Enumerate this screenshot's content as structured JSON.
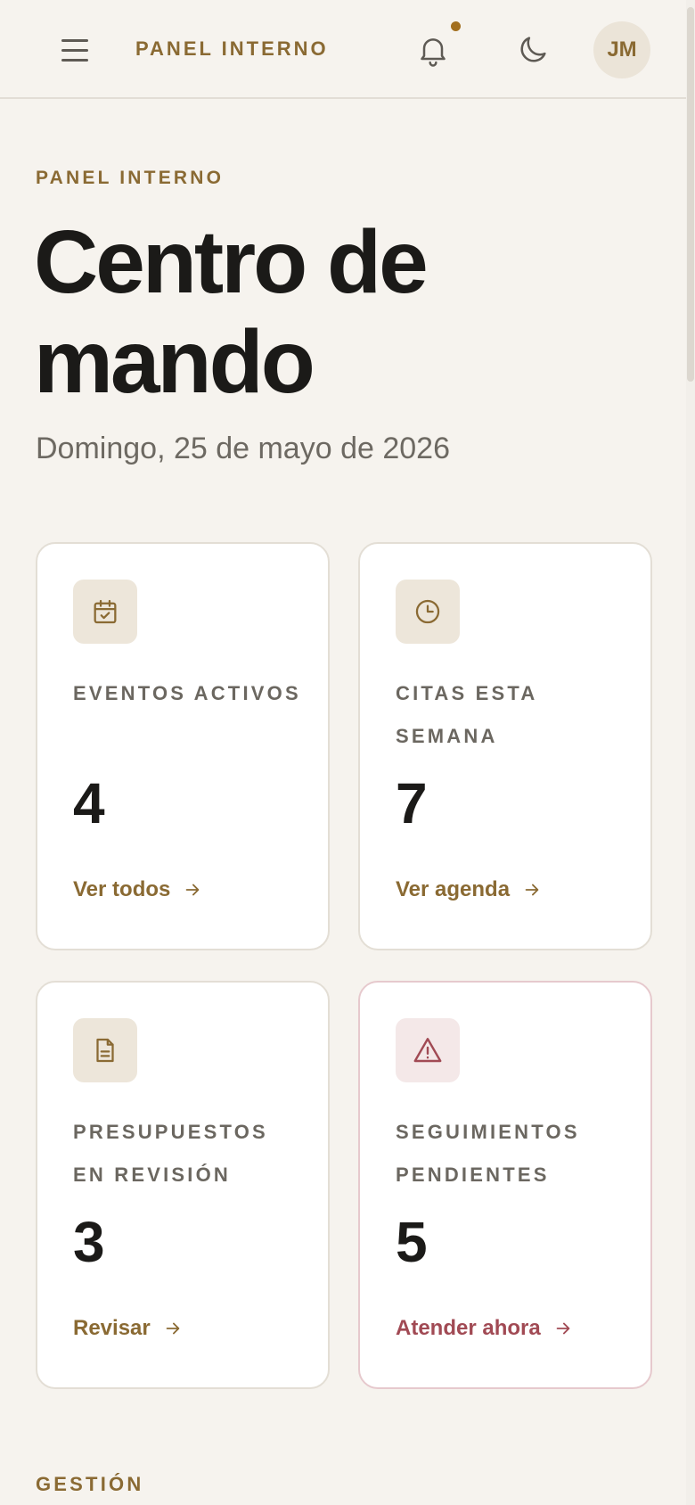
{
  "header": {
    "brand": "PANEL INTERNO",
    "avatar_initials": "JM",
    "menu_icon": "hamburger-menu-icon",
    "notification_icon": "bell-icon",
    "theme_icon": "moon-icon",
    "has_unread_notifications": true
  },
  "hero": {
    "eyebrow": "PANEL INTERNO",
    "title": "Centro de mando",
    "date": "Domingo, 25 de mayo de 2026"
  },
  "cards": [
    {
      "icon": "calendar-check-icon",
      "label": "EVENTOS ACTIVOS",
      "value": "4",
      "link": "Ver todos",
      "variant": "default"
    },
    {
      "icon": "clock-icon",
      "label": "CITAS ESTA SEMANA",
      "value": "7",
      "link": "Ver agenda",
      "variant": "default"
    },
    {
      "icon": "document-icon",
      "label": "PRESUPUESTOS EN REVISIÓN",
      "value": "3",
      "link": "Revisar",
      "variant": "default"
    },
    {
      "icon": "warning-triangle-icon",
      "label": "SEGUIMIENTOS PENDIENTES",
      "value": "5",
      "link": "Atender ahora",
      "variant": "alert"
    }
  ],
  "sections": {
    "management_label": "GESTIÓN"
  },
  "colors": {
    "accent": "#8a6a33",
    "alert": "#a14a54",
    "background": "#f6f3ee",
    "notification_dot": "#a26f1f"
  }
}
